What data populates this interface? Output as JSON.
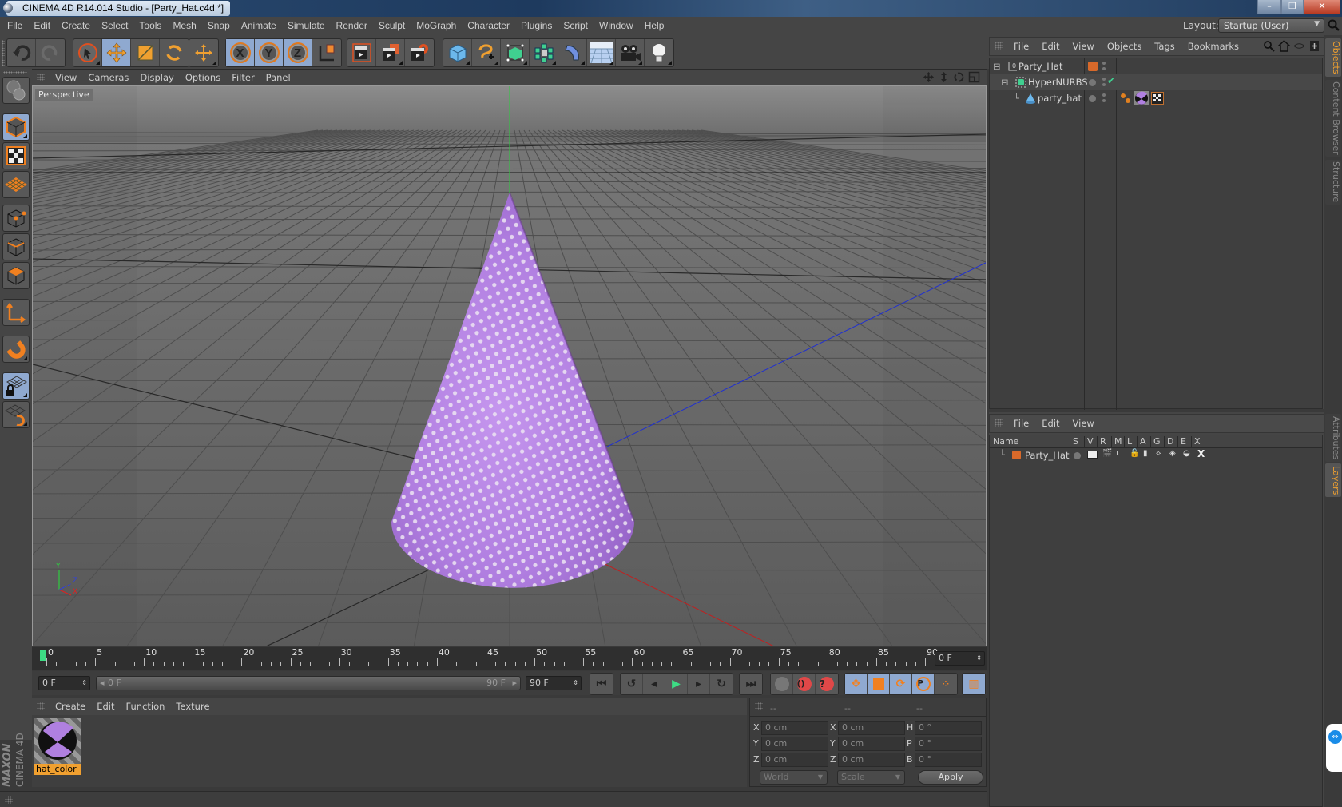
{
  "window": {
    "title": "CINEMA 4D R14.014 Studio - [Party_Hat.c4d *]",
    "controls": {
      "minimize": "–",
      "restore": "❐",
      "close": "✕"
    }
  },
  "menubar": {
    "items": [
      "File",
      "Edit",
      "Create",
      "Select",
      "Tools",
      "Mesh",
      "Snap",
      "Animate",
      "Simulate",
      "Render",
      "Sculpt",
      "MoGraph",
      "Character",
      "Plugins",
      "Script",
      "Window",
      "Help"
    ],
    "layout_label": "Layout:",
    "layout_value": "Startup (User)"
  },
  "toolbar": {
    "groups": [
      {
        "name": "history",
        "items": [
          "undo-icon",
          "redo-icon"
        ]
      },
      {
        "name": "tools",
        "items": [
          "live-selection-icon",
          "move-icon",
          "scale-icon",
          "rotate-icon"
        ]
      },
      {
        "name": "create",
        "items": [
          "add-object-icon"
        ]
      },
      {
        "name": "axis",
        "items": [
          "x-axis-lock",
          "y-axis-lock",
          "z-axis-lock",
          "coordinate-system-icon"
        ]
      },
      {
        "name": "render",
        "items": [
          "render-view-icon",
          "render-picture-viewer-icon",
          "render-settings-icon"
        ]
      },
      {
        "name": "objects",
        "items": [
          "cube-icon",
          "spline-pen-icon",
          "nurbs-icon",
          "array-icon",
          "deformer-icon",
          "floor-icon",
          "camera-icon",
          "light-icon"
        ]
      }
    ],
    "axis_labels": [
      "X",
      "Y",
      "Z"
    ]
  },
  "left_palette": {
    "items": [
      "make-editable-icon",
      "model-mode-icon",
      "texture-mode-icon",
      "workplane-mode-icon",
      "points-mode-icon",
      "edges-mode-icon",
      "polygons-mode-icon",
      "axis-mode-icon",
      "snap-magnet-icon",
      "workplane-lock-icon",
      "workplane-align-icon"
    ]
  },
  "viewport": {
    "menu": [
      "View",
      "Cameras",
      "Display",
      "Options",
      "Filter",
      "Panel"
    ],
    "label": "Perspective",
    "nav_icons": [
      "pan-icon",
      "zoom-icon",
      "orbit-icon",
      "maximize-icon"
    ],
    "axis_gizmo": {
      "y": "Y",
      "z": "Z",
      "x": "X"
    },
    "object_color": "#b57fe0",
    "dot_color": "#e8dff0"
  },
  "timeline": {
    "ticks": [
      0,
      5,
      10,
      15,
      20,
      25,
      30,
      35,
      40,
      45,
      50,
      55,
      60,
      65,
      70,
      75,
      80,
      85,
      90
    ],
    "current_frame_display": "0 F",
    "start_field": "0 F",
    "range_start": "0 F",
    "range_end": "90 F",
    "end_field": "90 F",
    "playhead_color": "#3ddc84"
  },
  "transport": {
    "buttons": [
      "go-to-start",
      "play-backwards-loop",
      "previous-frame",
      "play",
      "next-frame",
      "loop",
      "go-to-end"
    ],
    "keyframe_buttons": [
      "autokey",
      "record",
      "keyframe-help"
    ],
    "track_buttons": [
      "record-position",
      "record-scale",
      "record-rotation",
      "record-parameter",
      "record-point-level"
    ],
    "timeline_toggle": "timeline-icon"
  },
  "material_manager": {
    "menu": [
      "Create",
      "Edit",
      "Function",
      "Texture"
    ],
    "materials": [
      {
        "name": "hat_color",
        "selected": true
      }
    ]
  },
  "branding": {
    "line1": "MAXON",
    "line2": "CINEMA 4D"
  },
  "coordinates": {
    "headers": [
      "--",
      "--",
      "--"
    ],
    "rows": [
      {
        "pos_label": "X",
        "pos": "0 cm",
        "size_label": "X",
        "size": "0 cm",
        "rot_label": "H",
        "rot": "0 °"
      },
      {
        "pos_label": "Y",
        "pos": "0 cm",
        "size_label": "Y",
        "size": "0 cm",
        "rot_label": "P",
        "rot": "0 °"
      },
      {
        "pos_label": "Z",
        "pos": "0 cm",
        "size_label": "Z",
        "size": "0 cm",
        "rot_label": "B",
        "rot": "0 °"
      }
    ],
    "mode_select": "World",
    "type_select": "Scale",
    "apply_label": "Apply"
  },
  "object_manager": {
    "menu": [
      "File",
      "Edit",
      "View",
      "Objects",
      "Tags",
      "Bookmarks"
    ],
    "objects": [
      {
        "name": "Party_Hat",
        "type": "null",
        "depth": 0,
        "layer_color": "#d8692a"
      },
      {
        "name": "HyperNURBS",
        "type": "hypernurbs",
        "depth": 1,
        "enabled": "✔"
      },
      {
        "name": "party_hat",
        "type": "cone",
        "depth": 2,
        "tags": [
          "phong-tag",
          "material-tag",
          "uvw-tag"
        ]
      }
    ]
  },
  "layer_manager": {
    "menu": [
      "File",
      "Edit",
      "View"
    ],
    "columns": [
      "Name",
      "S",
      "V",
      "R",
      "M",
      "L",
      "A",
      "G",
      "D",
      "E",
      "X"
    ],
    "layers": [
      {
        "name": "Party_Hat",
        "color": "#d8692a"
      }
    ]
  },
  "side_tabs": {
    "top": [
      {
        "label": "Objects",
        "active": true
      },
      {
        "label": "Content Browser",
        "active": false
      },
      {
        "label": "Structure",
        "active": false
      }
    ],
    "bottom": [
      {
        "label": "Attributes",
        "active": false
      },
      {
        "label": "Layers",
        "active": true
      }
    ]
  },
  "colors": {
    "accent": "#f0a030",
    "selected_button": "#8fa9d0",
    "panel": "#454545"
  }
}
